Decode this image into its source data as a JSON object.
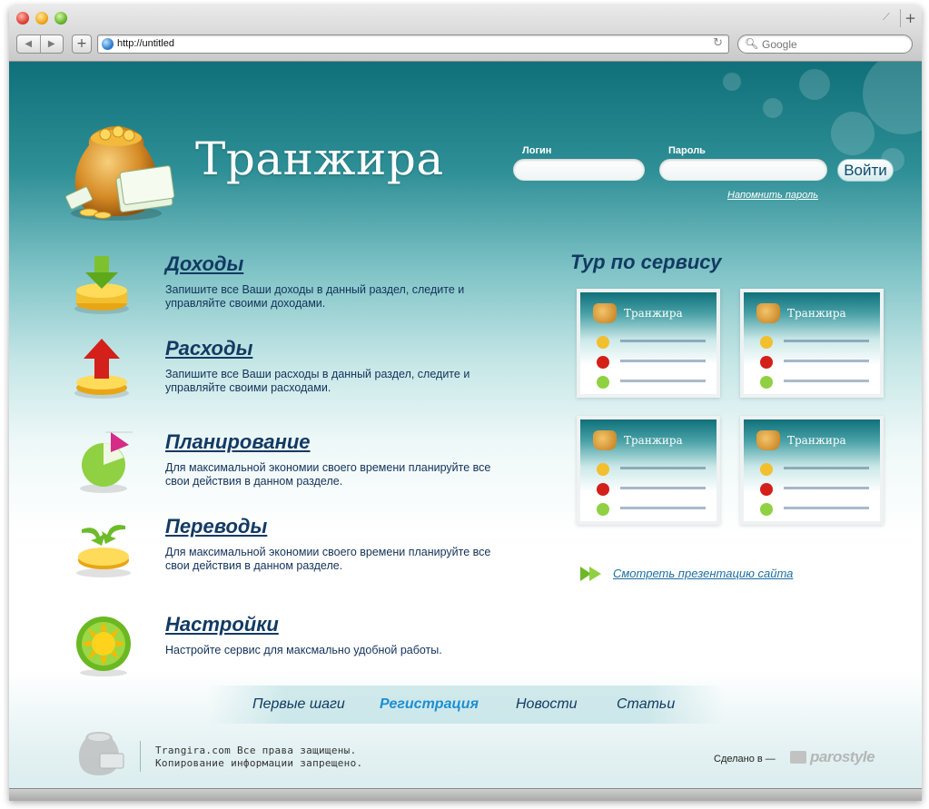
{
  "browser": {
    "url": "http://untitled",
    "search_placeholder": "Google"
  },
  "site": {
    "brand": "Транжира",
    "login": {
      "login_label": "Логин",
      "password_label": "Пароль",
      "submit_label": "Войти",
      "remind_label": "Напомнить пароль"
    }
  },
  "features": [
    {
      "title": "Доходы",
      "desc": "Запишите все Ваши доходы в данный раздел, следите и управляйте своими доходами."
    },
    {
      "title": "Расходы",
      "desc": "Запишите все Ваши расходы в данный раздел, следите и управляйте своими расходами."
    },
    {
      "title": "Планирование",
      "desc": "Для максимальной экономии своего времени планируйте все свои действия в данном разделе."
    },
    {
      "title": "Переводы",
      "desc": "Для максимальной экономии своего времени планируйте все свои действия в данном разделе."
    },
    {
      "title": "Настройки",
      "desc": "Настройте сервис для максмально удобной работы."
    }
  ],
  "tour": {
    "title": "Тур по сервису",
    "thumb_brand": "Транжира",
    "present_label": "Смотреть презентацию сайта"
  },
  "footer": {
    "nav": [
      "Первые шаги",
      "Регистрация",
      "Новости",
      "Статьи"
    ],
    "copyright_line1": "Trangira.com Все права защищены.",
    "copyright_line2": "Копирование информации запрещено.",
    "made_by": "Сделано в —",
    "parostyle": "parostyle"
  }
}
